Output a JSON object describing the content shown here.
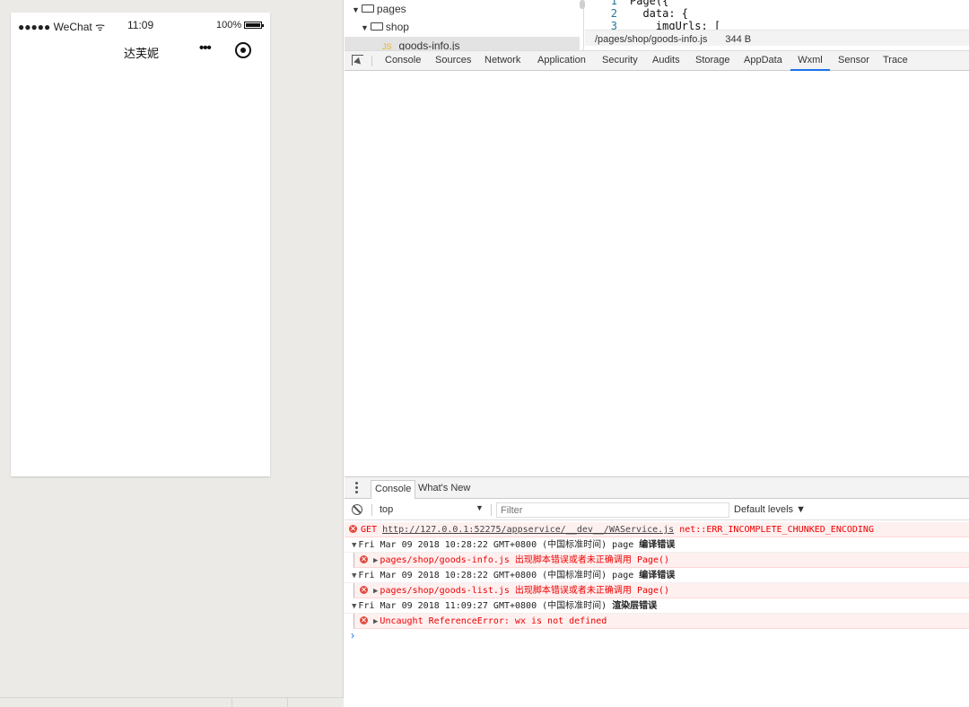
{
  "simulator": {
    "status_bar": {
      "carrier": "●●●●● WeChat",
      "wifi_icon": "wifi-icon",
      "time": "11:09",
      "battery": "100%"
    },
    "nav": {
      "title": "达芙妮",
      "more": "•••"
    }
  },
  "editor": {
    "tree": {
      "folder_pages": "pages",
      "folder_shop": "shop",
      "selected_file": "goods-info.js"
    },
    "code": [
      {
        "ln": "1",
        "text": "Page({"
      },
      {
        "ln": "2",
        "text": "  data: {"
      },
      {
        "ln": "3",
        "text": "    imgUrls: ["
      }
    ],
    "file_path": "/pages/shop/goods-info.js",
    "file_size": "344 B"
  },
  "devtools": {
    "tabs": [
      "Console",
      "Sources",
      "Network",
      "Application",
      "Security",
      "Audits",
      "Storage",
      "AppData",
      "Wxml",
      "Sensor",
      "Trace"
    ],
    "active_tab": "Wxml"
  },
  "drawer": {
    "tabs": [
      "Console",
      "What's New"
    ],
    "context": "top",
    "filter_placeholder": "Filter",
    "levels": "Default levels ▼",
    "logs": {
      "get_prefix": "GET ",
      "get_url": "http://127.0.0.1:52275/appservice/__dev__/WAService.js",
      "get_error": " net::ERR_INCOMPLETE_CHUNKED_ENCODING",
      "group1_time": "Fri Mar 09 2018 10:28:22 GMT+0800 (中国标准时间) page ",
      "group1_label": "编译错误",
      "err1": "pages/shop/goods-info.js 出现脚本错误或者未正确调用 Page()",
      "group2_time": "Fri Mar 09 2018 10:28:22 GMT+0800 (中国标准时间) page ",
      "group2_label": "编译错误",
      "err2": "pages/shop/goods-list.js 出现脚本错误或者未正确调用 Page()",
      "group3_time": "Fri Mar 09 2018 11:09:27 GMT+0800 (中国标准时间) ",
      "group3_label": "渲染层错误",
      "err3": "Uncaught ReferenceError: wx is not defined"
    },
    "prompt": "›"
  }
}
